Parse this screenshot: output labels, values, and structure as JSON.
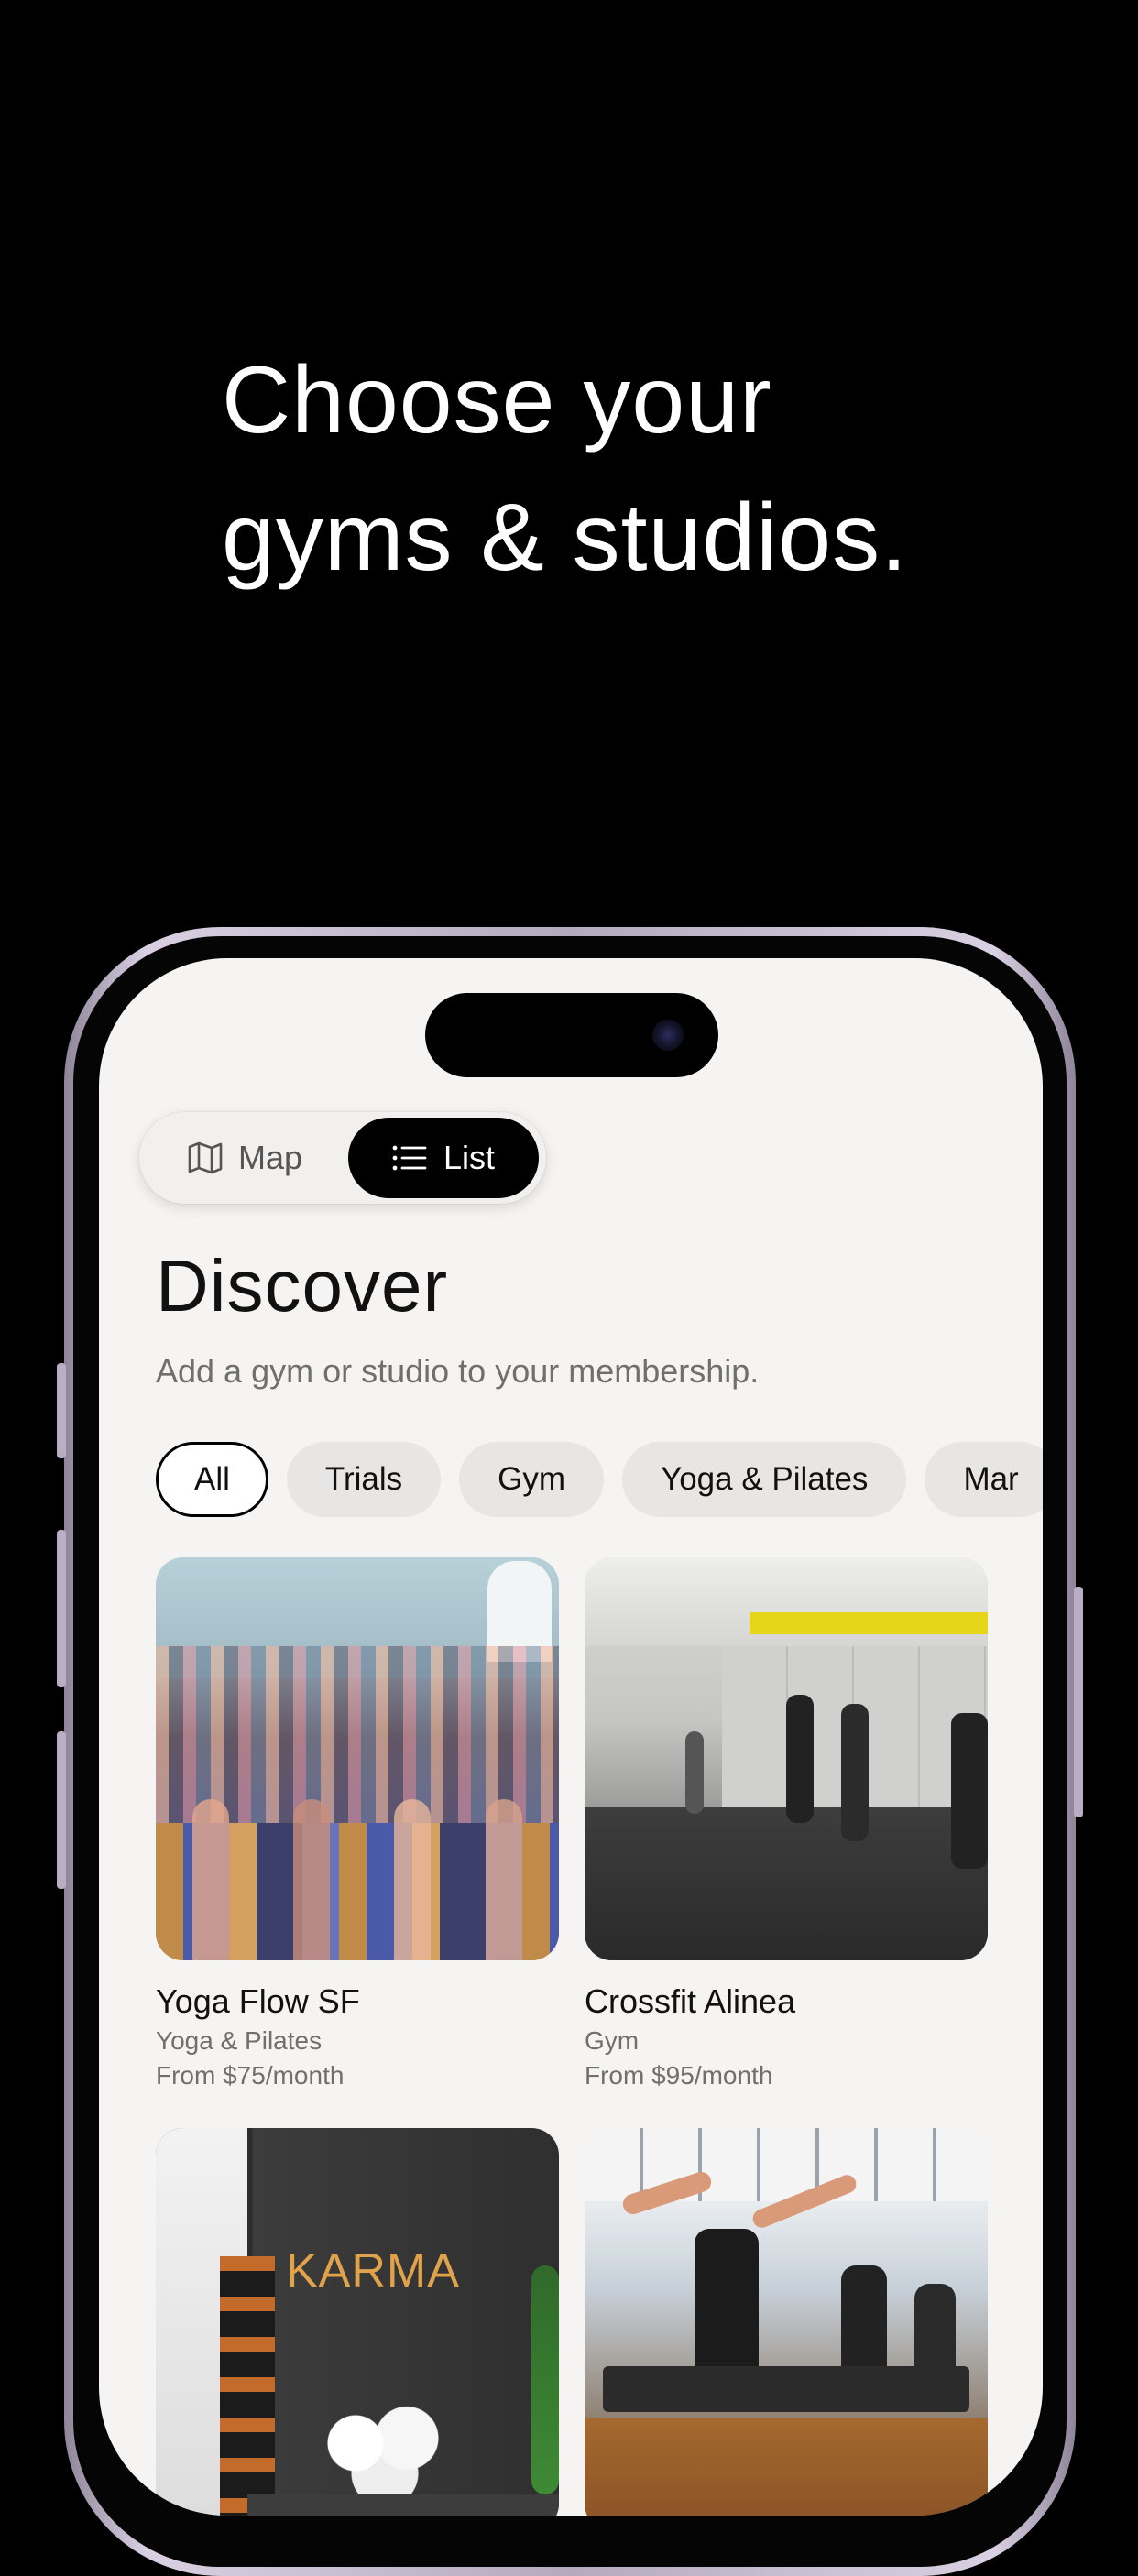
{
  "headline": {
    "line1": "Choose your",
    "line2": "gyms & studios."
  },
  "toggle": {
    "map_label": "Map",
    "list_label": "List",
    "selected": "List"
  },
  "discover": {
    "title": "Discover",
    "subtitle": "Add a gym or studio to your membership."
  },
  "filters": [
    "All",
    "Trials",
    "Gym",
    "Yoga & Pilates",
    "Mar"
  ],
  "active_filter": "All",
  "cards": [
    {
      "name": "Yoga Flow SF",
      "category": "Yoga & Pilates",
      "price": "From $75/month",
      "image": "yoga-class-photo"
    },
    {
      "name": "Crossfit Alinea",
      "category": "Gym",
      "price": "From $95/month",
      "image": "crossfit-handstand-photo"
    },
    {
      "name": "",
      "category": "",
      "price": "",
      "image": "karma-studio-photo",
      "sign_text": "KARMA"
    },
    {
      "name": "",
      "category": "",
      "price": "",
      "image": "pilates-class-photo"
    }
  ],
  "colors": {
    "background": "#000000",
    "screen": "#f5f4f2",
    "accent": "#000000",
    "muted_text": "#6f6f6f"
  },
  "icons": {
    "map": "map-icon",
    "list": "list-icon"
  }
}
